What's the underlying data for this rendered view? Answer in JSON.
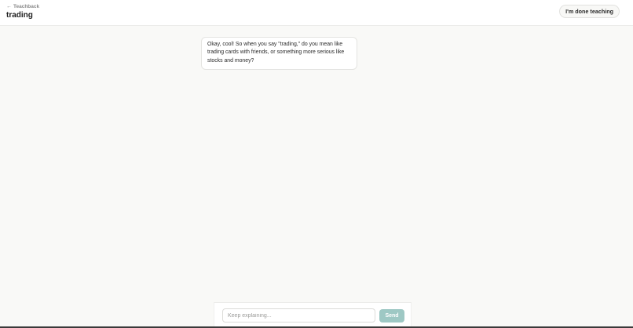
{
  "header": {
    "back_label": "Teachback",
    "back_arrow": "←",
    "title": "trading",
    "done_label": "I'm done teaching"
  },
  "chat": {
    "messages": [
      {
        "role": "assistant",
        "text": "Okay, cool! So when you say \"trading,\" do you mean like trading cards with friends, or something more serious like stocks and money?"
      }
    ]
  },
  "composer": {
    "placeholder": "Keep explaining...",
    "value": "",
    "send_label": "Send"
  },
  "colors": {
    "background": "#f9f9f7",
    "send_button": "#9ec8c4"
  }
}
